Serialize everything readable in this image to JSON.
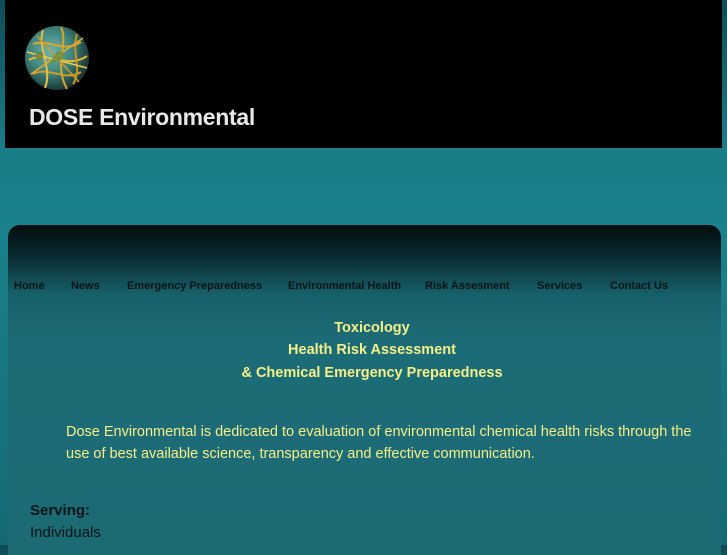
{
  "site": {
    "title": "DOSE Environmental",
    "logo_icon": "globe-icon"
  },
  "nav": {
    "items": [
      {
        "label": "Home"
      },
      {
        "label": "News"
      },
      {
        "label": "Emergency Preparedness"
      },
      {
        "label": "Environmental Health"
      },
      {
        "label": "Risk Assesment"
      },
      {
        "label": "Services"
      },
      {
        "label": "Contact Us"
      }
    ]
  },
  "hero": {
    "line1": "Toxicology",
    "line2": "Health Risk Assessment",
    "line3": "& Chemical Emergency Preparedness"
  },
  "intro": {
    "text": "Dose Environmental is dedicated to evaluation of environmental chemical health risks through the use of best available science, transparency and effective communication."
  },
  "serving": {
    "label": "Serving:",
    "items": [
      "Individuals"
    ]
  },
  "colors": {
    "header_bg": "#000000",
    "accent_text": "#f5f089",
    "nav_text": "#0a1416",
    "page_teal": "#1b818c"
  }
}
